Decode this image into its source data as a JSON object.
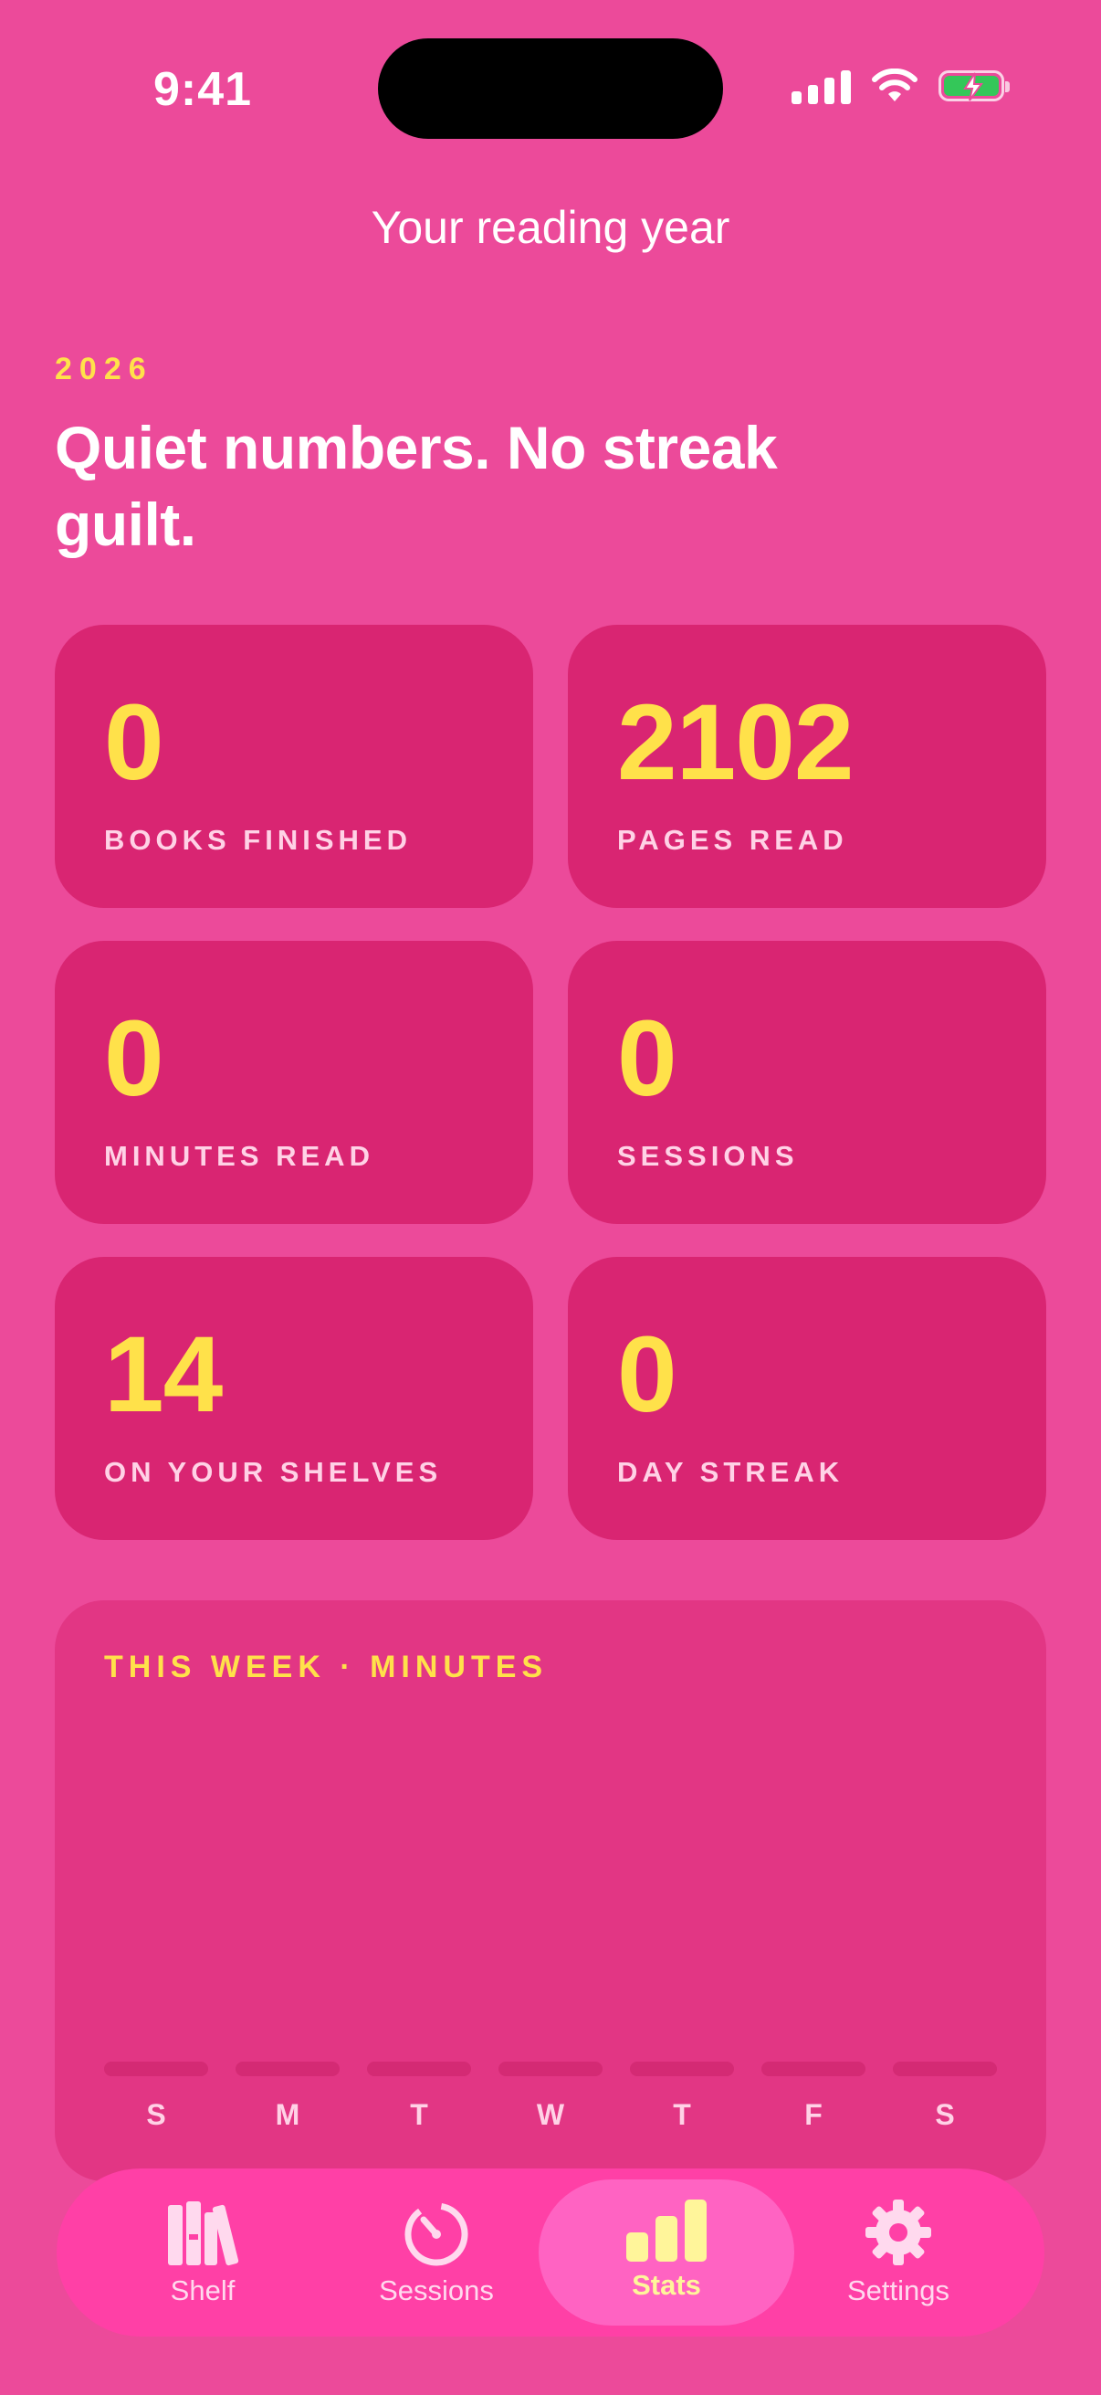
{
  "status_bar": {
    "time": "9:41"
  },
  "nav": {
    "title": "Your reading year"
  },
  "hero": {
    "year": "2026",
    "headline": "Quiet numbers. No streak guilt."
  },
  "stats": [
    {
      "value": "0",
      "label": "BOOKS FINISHED"
    },
    {
      "value": "2102",
      "label": "PAGES READ"
    },
    {
      "value": "0",
      "label": "MINUTES READ"
    },
    {
      "value": "0",
      "label": "SESSIONS"
    },
    {
      "value": "14",
      "label": "ON YOUR SHELVES"
    },
    {
      "value": "0",
      "label": "DAY STREAK"
    }
  ],
  "week_chart": {
    "title": "THIS WEEK · MINUTES",
    "days": [
      "S",
      "M",
      "T",
      "W",
      "T",
      "F",
      "S"
    ],
    "values": [
      0,
      0,
      0,
      0,
      0,
      0,
      0
    ]
  },
  "tabs": [
    {
      "label": "Shelf",
      "icon": "books-icon",
      "active": false
    },
    {
      "label": "Sessions",
      "icon": "timer-icon",
      "active": false
    },
    {
      "label": "Stats",
      "icon": "bar-chart-icon",
      "active": true
    },
    {
      "label": "Settings",
      "icon": "gear-icon",
      "active": false
    }
  ],
  "colors": {
    "background": "#EC4A9A",
    "card": "#D92572",
    "accent": "#FFE14A",
    "tabbar": "#FF40A6"
  }
}
